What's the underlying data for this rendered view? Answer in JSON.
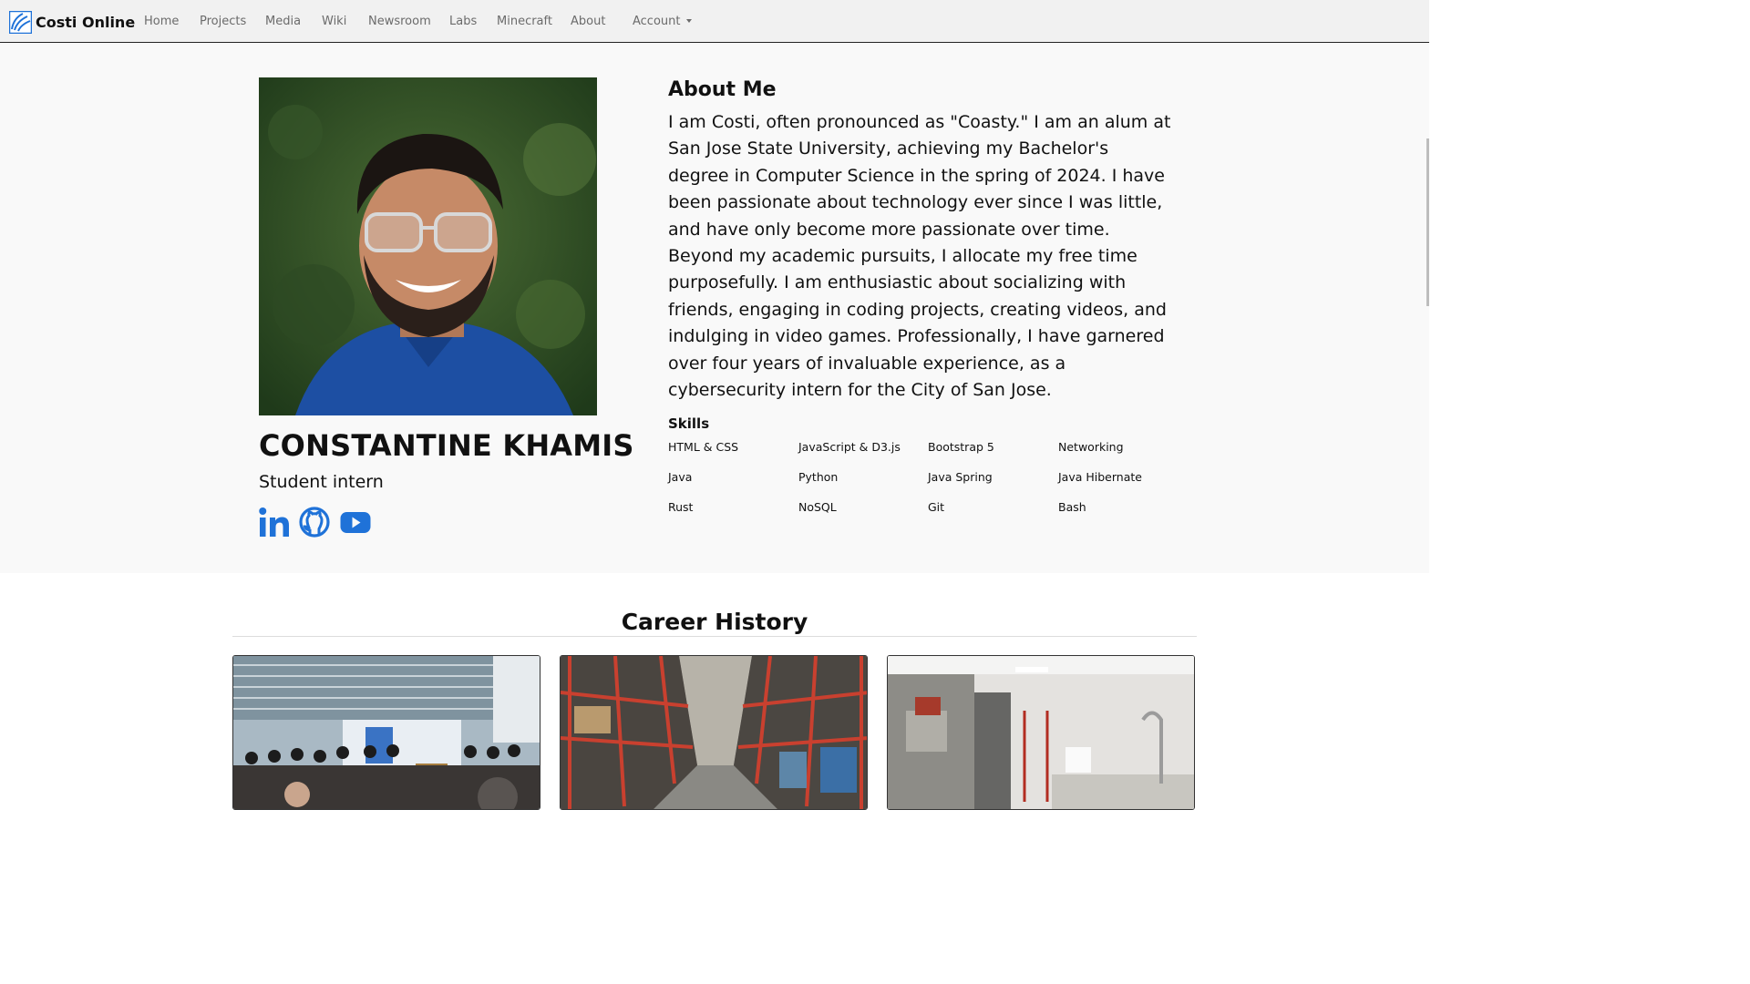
{
  "navbar": {
    "brand": "Costi Online",
    "links": [
      "Home",
      "Projects",
      "Media",
      "Wiki",
      "Newsroom",
      "Labs",
      "Minecraft",
      "About"
    ],
    "account_label": "Account"
  },
  "profile": {
    "name": "CONSTANTINE KHAMIS",
    "role": "Student intern",
    "social_icons": [
      "linkedin-icon",
      "github-icon",
      "youtube-icon"
    ],
    "accent_color": "#1f72d8"
  },
  "about": {
    "title": "About Me",
    "paragraphs": [
      "I am Costi, often pronounced as \"Coasty.\" I am an alum at San Jose State University, achieving my Bachelor's degree in Computer Science in the spring of 2024. I have been passionate about technology ever since I was little, and have only become more passionate over time.",
      "Beyond my academic pursuits, I allocate my free time purposefully. I am enthusiastic about socializing with friends, engaging in coding projects, creating videos, and indulging in video games. Professionally, I have garnered over four years of invaluable experience, as a cybersecurity intern for the City of San Jose."
    ]
  },
  "skills": {
    "title": "Skills",
    "items": [
      "HTML & CSS",
      "JavaScript & D3.js",
      "Bootstrap 5",
      "Networking",
      "Java",
      "Python",
      "Java Spring",
      "Java Hibernate",
      "Rust",
      "NoSQL",
      "Git",
      "Bash"
    ]
  },
  "career": {
    "title": "Career History"
  }
}
